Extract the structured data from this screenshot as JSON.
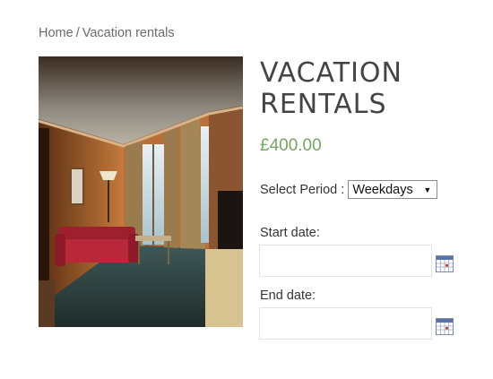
{
  "breadcrumb": {
    "home": "Home",
    "separator": "/",
    "current": "Vacation rentals"
  },
  "product": {
    "image_alt": "Hotel room with red sofa",
    "title": "VACATION RENTALS",
    "price": "£400.00",
    "price_color": "#77a464"
  },
  "form": {
    "period_label": "Select Period :",
    "period_selected": "Weekdays",
    "start_label": "Start date:",
    "start_value": "",
    "end_label": "End date:",
    "end_value": "",
    "calendar_icon": "calendar-icon"
  }
}
